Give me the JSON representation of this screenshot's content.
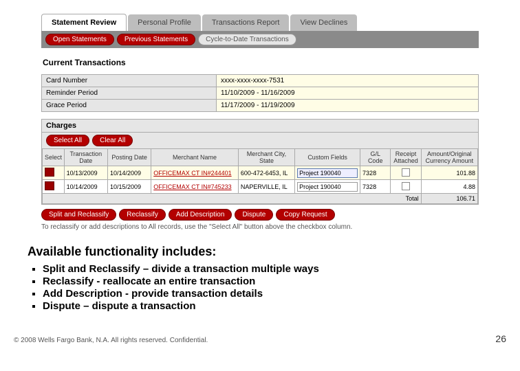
{
  "tabs": {
    "t0": "Statement Review",
    "t1": "Personal Profile",
    "t2": "Transactions Report",
    "t3": "View Declines"
  },
  "subtabs": {
    "s0": "Open Statements",
    "s1": "Previous Statements",
    "s2": "Cycle-to-Date Transactions"
  },
  "section_title": "Current Transactions",
  "info": {
    "card_label": "Card Number",
    "card_value": "xxxx-xxxx-xxxx-7531",
    "reminder_label": "Reminder Period",
    "reminder_value": "11/10/2009 - 11/16/2009",
    "grace_label": "Grace Period",
    "grace_value": "11/17/2009 - 11/19/2009"
  },
  "charges": {
    "title": "Charges",
    "select_all": "Select All",
    "clear_all": "Clear All",
    "cols": {
      "sel": "Select",
      "tdate": "Transaction Date",
      "pdate": "Posting Date",
      "merchant": "Merchant Name",
      "city": "Merchant City, State",
      "custom": "Custom Fields",
      "gl": "G/L Code",
      "receipt": "Receipt Attached",
      "amount": "Amount/Original Currency Amount"
    }
  },
  "rows": [
    {
      "tdate": "10/13/2009",
      "pdate": "10/14/2009",
      "merchant": "OFFICEMAX CT IN#244401",
      "city": "600-472-6453, IL",
      "custom": "Project 190040",
      "gl": "7328",
      "receipt": "",
      "amount": "101.88"
    },
    {
      "tdate": "10/14/2009",
      "pdate": "10/15/2009",
      "merchant": "OFFICEMAX CT IN#745233",
      "city": "NAPERVILLE, IL",
      "custom": "Project 190040",
      "gl": "7328",
      "receipt": "",
      "amount": "4.88"
    }
  ],
  "totals": {
    "label": "Total",
    "value": "106.71"
  },
  "actions": {
    "a0": "Split and Reclassify",
    "a1": "Reclassify",
    "a2": "Add Description",
    "a3": "Dispute",
    "a4": "Copy Request"
  },
  "hint": "To reclassify or add descriptions to All records, use the \"Select All\" button above the checkbox column.",
  "func": {
    "heading": "Available functionality includes:",
    "b0": "Split and Reclassify – divide a transaction multiple ways",
    "b1": "Reclassify - reallocate an entire transaction",
    "b2": "Add Description - provide transaction details",
    "b3": "Dispute – dispute a transaction"
  },
  "footer": {
    "copy": "© 2008 Wells Fargo Bank, N.A. All rights reserved. Confidential.",
    "page": "26"
  }
}
